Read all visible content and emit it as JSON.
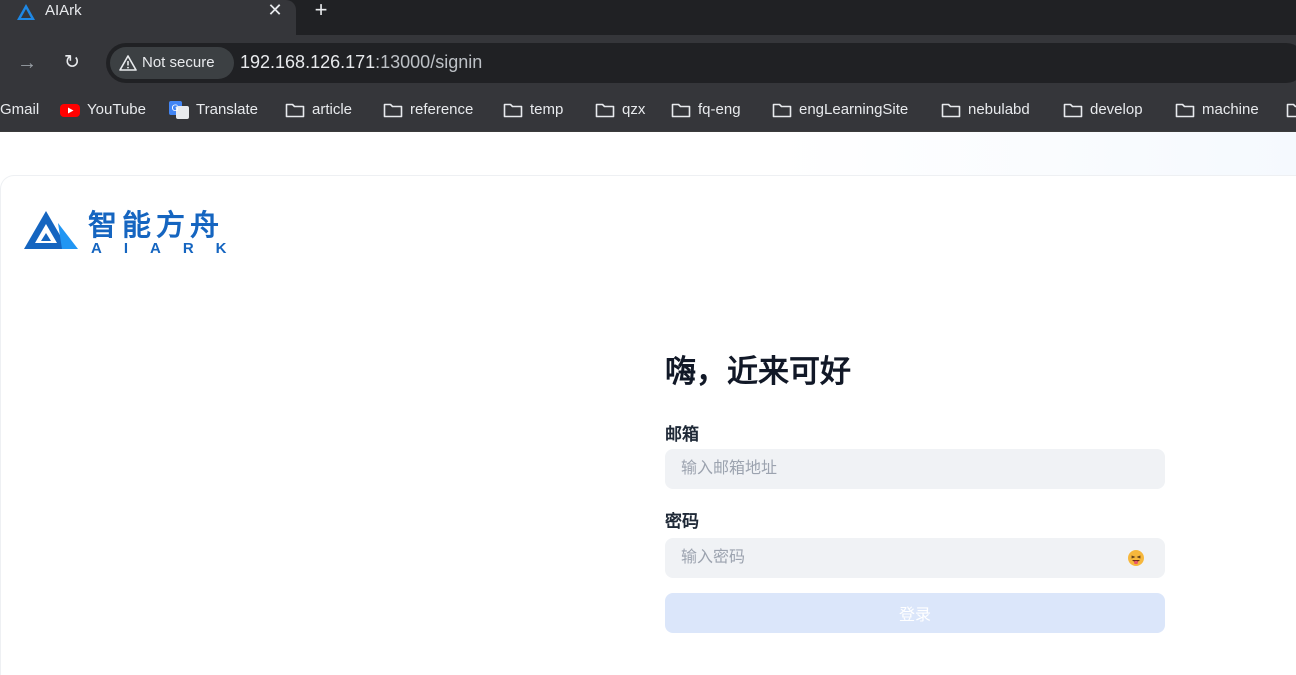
{
  "browser": {
    "tab": {
      "title": "AIArk",
      "close_glyph": "✕"
    },
    "new_tab_glyph": "+",
    "nav": {
      "forward_glyph": "→",
      "reload_glyph": "↻"
    },
    "security_chip": {
      "icon": "warning-triangle-icon",
      "label": "Not secure"
    },
    "url": {
      "host": "192.168.126.171",
      "rest": ":13000/signin"
    },
    "bookmarks": [
      {
        "label": "Gmail",
        "icon": "gmail-icon"
      },
      {
        "label": "YouTube",
        "icon": "youtube-icon"
      },
      {
        "label": "Translate",
        "icon": "translate-icon"
      },
      {
        "label": "article",
        "icon": "folder-icon"
      },
      {
        "label": "reference",
        "icon": "folder-icon"
      },
      {
        "label": "temp",
        "icon": "folder-icon"
      },
      {
        "label": "qzx",
        "icon": "folder-icon"
      },
      {
        "label": "fq-eng",
        "icon": "folder-icon"
      },
      {
        "label": "engLearningSite",
        "icon": "folder-icon"
      },
      {
        "label": "nebulabd",
        "icon": "folder-icon"
      },
      {
        "label": "develop",
        "icon": "folder-icon"
      },
      {
        "label": "machine",
        "icon": "folder-icon"
      }
    ]
  },
  "brand": {
    "name_cn": "智能方舟",
    "name_en": "AIARK",
    "color": "#1565c0"
  },
  "signin": {
    "greeting": "嗨，近来可好",
    "email_label": "邮箱",
    "email_placeholder": "输入邮箱地址",
    "password_label": "密码",
    "password_placeholder": "输入密码",
    "password_toggle_icon": "emoji-eye-toggle-icon",
    "submit_label": "登录"
  }
}
